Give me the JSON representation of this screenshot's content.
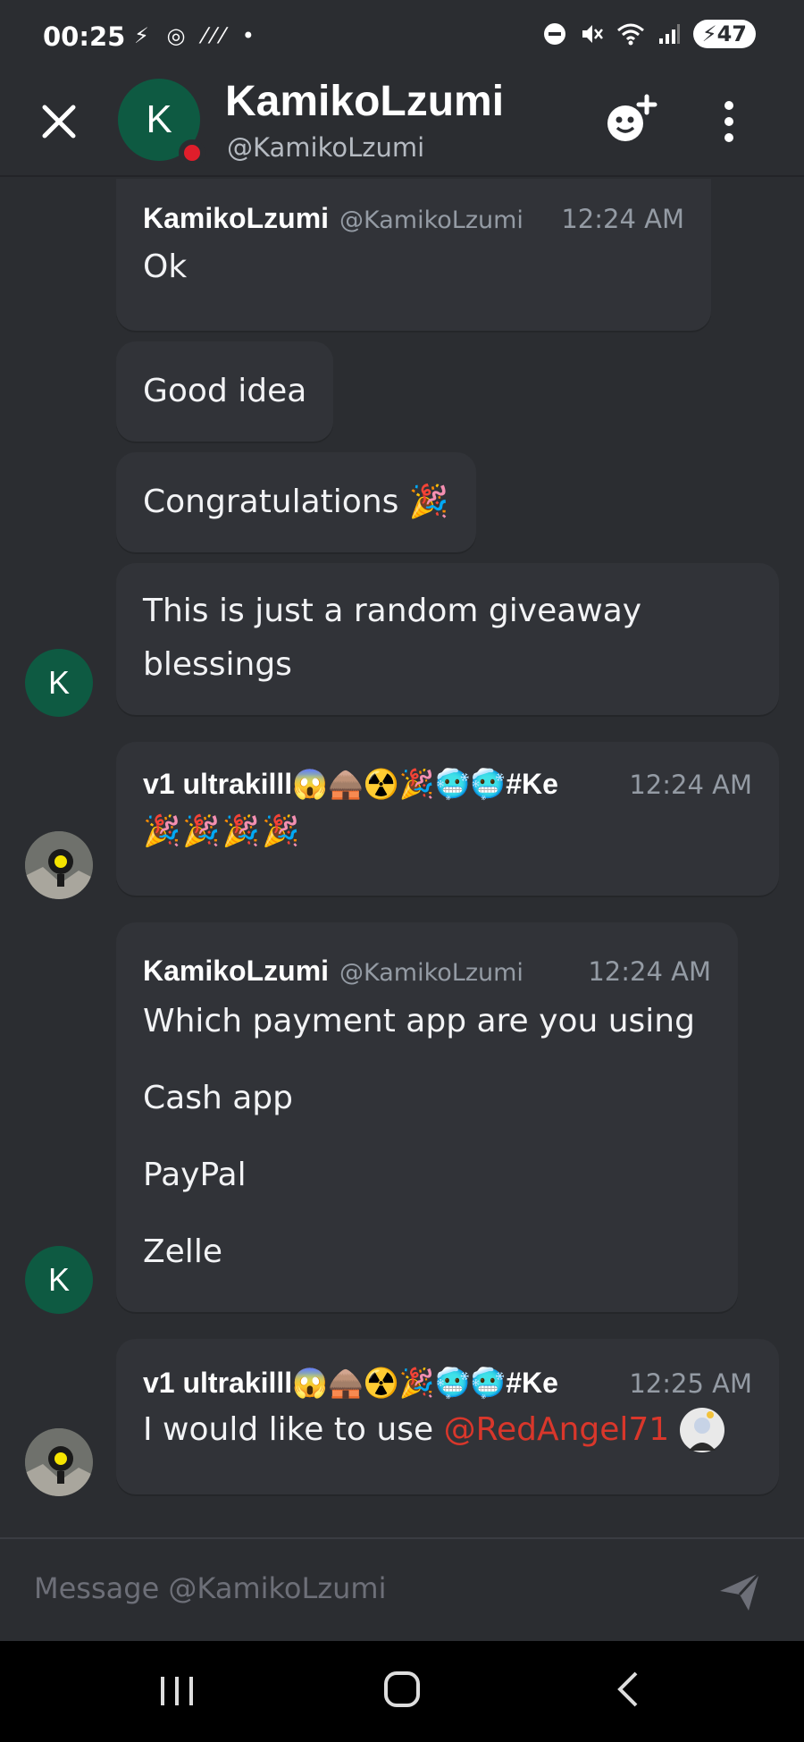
{
  "status_bar": {
    "time": "00:25",
    "left_icons": "⚡ ◎ ⁄⁄⁄ •",
    "battery": "47",
    "icons": [
      "do-not-disturb-icon",
      "mute-icon",
      "wifi-icon",
      "signal-icon",
      "battery-icon"
    ]
  },
  "header": {
    "avatar_letter": "K",
    "title": "KamikoLzumi",
    "handle": "@KamikoLzumi"
  },
  "messages": [
    {
      "author": "KamikoLzumi",
      "handle": "@KamikoLzumi",
      "time": "12:24 AM",
      "text": "Ok"
    },
    {
      "text": "Good idea"
    },
    {
      "text": "Congratulations 🎉"
    },
    {
      "text_line1": "This is just a random giveaway",
      "text_line2": "blessings",
      "avatar_letter": "K"
    },
    {
      "author": "v1 ultrakilll😱🛖☢️🎉🥶🥶#Ke",
      "time": "12:24 AM",
      "text": "🎉🎉🎉🎉"
    },
    {
      "author": "KamikoLzumi",
      "handle": "@KamikoLzumi",
      "time": "12:24 AM",
      "lines": [
        "Which payment app are you using",
        "Cash app",
        "PayPal",
        "Zelle"
      ],
      "avatar_letter": "K"
    },
    {
      "author": "v1 ultrakilll😱🛖☢️🎉🥶🥶#Ke",
      "time": "12:25 AM",
      "text_prefix": "I would like to use ",
      "mention": "@RedAngel71"
    }
  ],
  "input": {
    "placeholder": "Message @KamikoLzumi"
  },
  "colors": {
    "background": "#2b2d31",
    "bubble": "#313338",
    "accent_avatar": "#0e5a42",
    "status_offline_dot": "#e01e2b",
    "mention": "#d9372b"
  }
}
